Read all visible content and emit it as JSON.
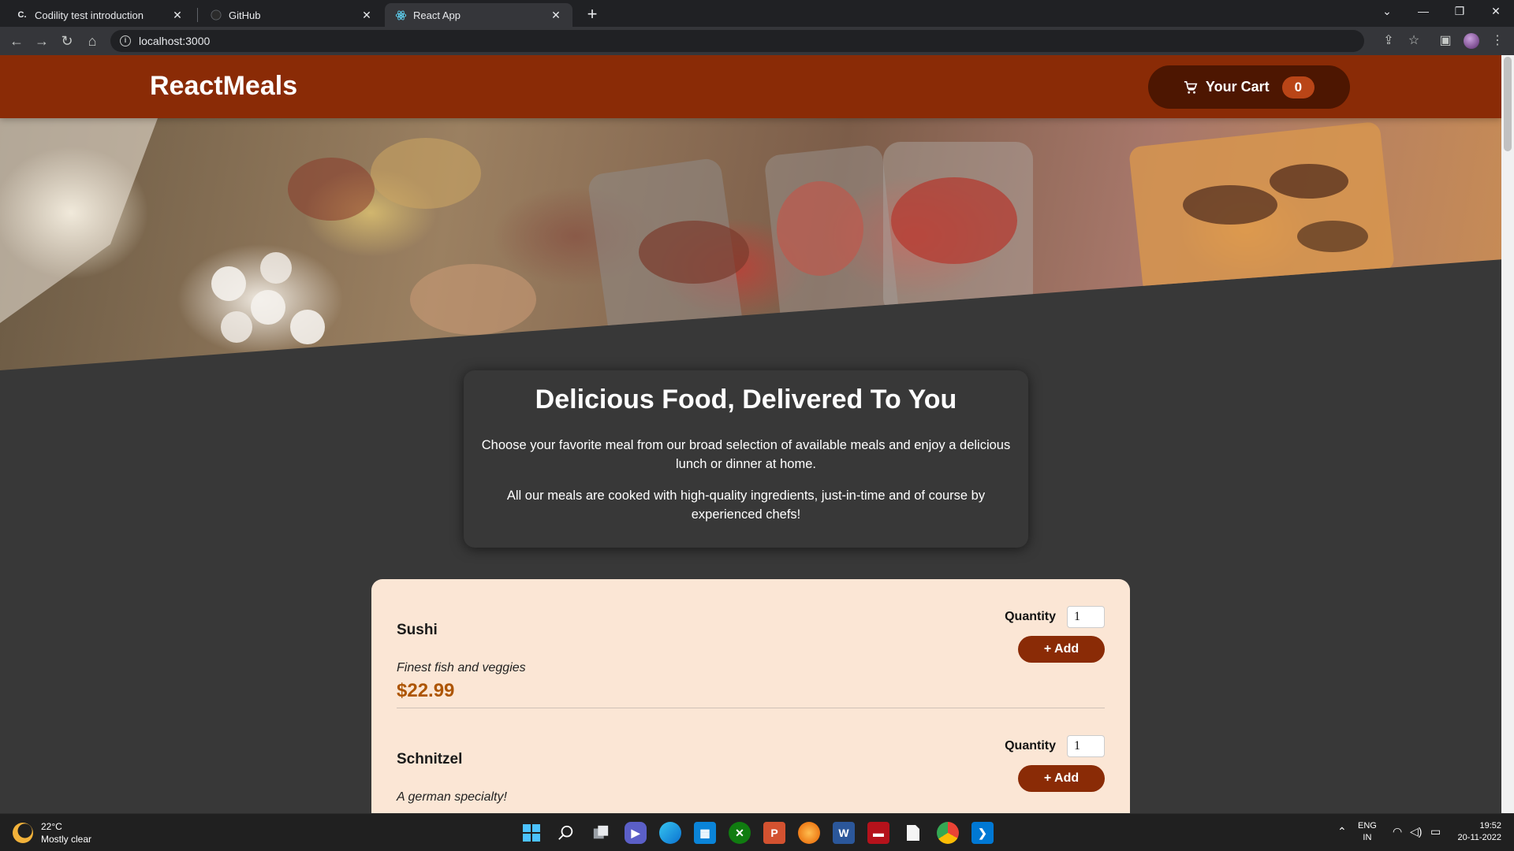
{
  "browser": {
    "tabs": [
      {
        "label": "Codility test introduction",
        "favicon": "C."
      },
      {
        "label": "GitHub",
        "favicon": ""
      },
      {
        "label": "React App",
        "favicon": ""
      }
    ],
    "url": "localhost:3000"
  },
  "header": {
    "brand": "ReactMeals",
    "cart_label": "Your Cart",
    "cart_count": "0"
  },
  "summary": {
    "title": "Delicious Food, Delivered To You",
    "p1": "Choose your favorite meal from our broad selection of available meals and enjoy a delicious lunch or dinner at home.",
    "p2": "All our meals are cooked with high-quality ingredients, just-in-time and of course by experienced chefs!"
  },
  "meals": [
    {
      "name": "Sushi",
      "description": "Finest fish and veggies",
      "price": "$22.99",
      "quantity_label": "Quantity",
      "quantity": "1",
      "add_label": "+ Add"
    },
    {
      "name": "Schnitzel",
      "description": "A german specialty!",
      "price": "",
      "quantity_label": "Quantity",
      "quantity": "1",
      "add_label": "+ Add"
    }
  ],
  "taskbar": {
    "weather_temp": "22°C",
    "weather_desc": "Mostly clear",
    "lang_top": "ENG",
    "lang_bottom": "IN",
    "time": "19:52",
    "date": "20-11-2022"
  },
  "colors": {
    "header": "#8a2b06",
    "cart_button": "#4d1601",
    "cart_badge": "#b94517",
    "meals_card": "#fbe6d5",
    "price": "#ad5502"
  }
}
